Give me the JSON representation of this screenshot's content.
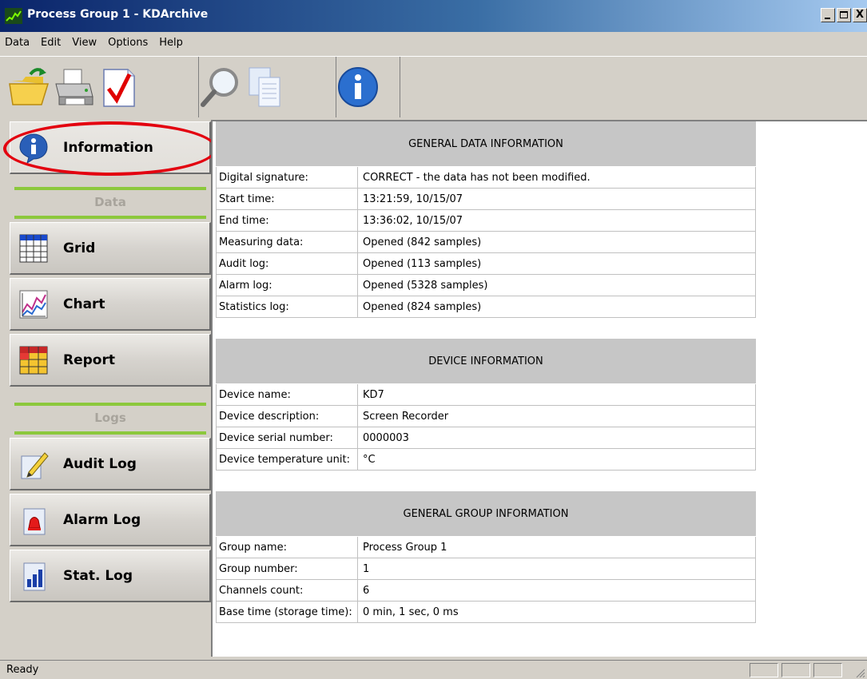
{
  "window": {
    "title": "Process Group 1 - KDArchive",
    "controls": {
      "minimize": "_",
      "maximize": "□",
      "close": "X"
    }
  },
  "menu": [
    {
      "label": "Data"
    },
    {
      "label": "Edit"
    },
    {
      "label": "View"
    },
    {
      "label": "Options"
    },
    {
      "label": "Help"
    }
  ],
  "toolbar": {
    "buttons": [
      {
        "icon": "open-folder-icon"
      },
      {
        "icon": "printer-icon"
      },
      {
        "icon": "checkmark-icon"
      },
      {
        "icon": "magnifier-icon"
      },
      {
        "icon": "copy-icon"
      },
      {
        "icon": "info-icon"
      }
    ]
  },
  "sidebar": {
    "information": {
      "label": "Information",
      "icon": "info-icon"
    },
    "data_section": "Data",
    "grid": {
      "label": "Grid",
      "icon": "grid-icon"
    },
    "chart": {
      "label": "Chart",
      "icon": "chart-icon"
    },
    "report": {
      "label": "Report",
      "icon": "report-icon"
    },
    "logs_section": "Logs",
    "audit_log": {
      "label": "Audit Log",
      "icon": "pencil-icon"
    },
    "alarm_log": {
      "label": "Alarm Log",
      "icon": "bell-icon"
    },
    "stat_log": {
      "label": "Stat. Log",
      "icon": "bar-chart-icon"
    }
  },
  "content": {
    "general_data": {
      "title": "GENERAL DATA INFORMATION",
      "rows": [
        {
          "key": "Digital signature:",
          "value": "CORRECT - the data has not been modified."
        },
        {
          "key": "Start time:",
          "value": "13:21:59, 10/15/07"
        },
        {
          "key": "End time:",
          "value": "13:36:02, 10/15/07"
        },
        {
          "key": "Measuring data:",
          "value": "Opened (842 samples)"
        },
        {
          "key": "Audit log:",
          "value": "Opened (113 samples)"
        },
        {
          "key": "Alarm log:",
          "value": "Opened (5328 samples)"
        },
        {
          "key": "Statistics log:",
          "value": "Opened (824 samples)"
        }
      ]
    },
    "device": {
      "title": "DEVICE INFORMATION",
      "rows": [
        {
          "key": "Device name:",
          "value": "KD7"
        },
        {
          "key": "Device description:",
          "value": "Screen Recorder"
        },
        {
          "key": "Device serial number:",
          "value": "0000003"
        },
        {
          "key": "Device temperature unit:",
          "value": "°C"
        }
      ]
    },
    "group": {
      "title": "GENERAL GROUP INFORMATION",
      "rows": [
        {
          "key": "Group name:",
          "value": "Process Group 1"
        },
        {
          "key": "Group number:",
          "value": "1"
        },
        {
          "key": "Channels count:",
          "value": "6"
        },
        {
          "key": "Base time (storage time):",
          "value": "0 min, 1 sec, 0 ms"
        }
      ]
    }
  },
  "status": {
    "text": "Ready"
  },
  "colors": {
    "highlight": "#e3000f",
    "section_line": "#8cc83c",
    "title_bar": "#0a246a"
  }
}
